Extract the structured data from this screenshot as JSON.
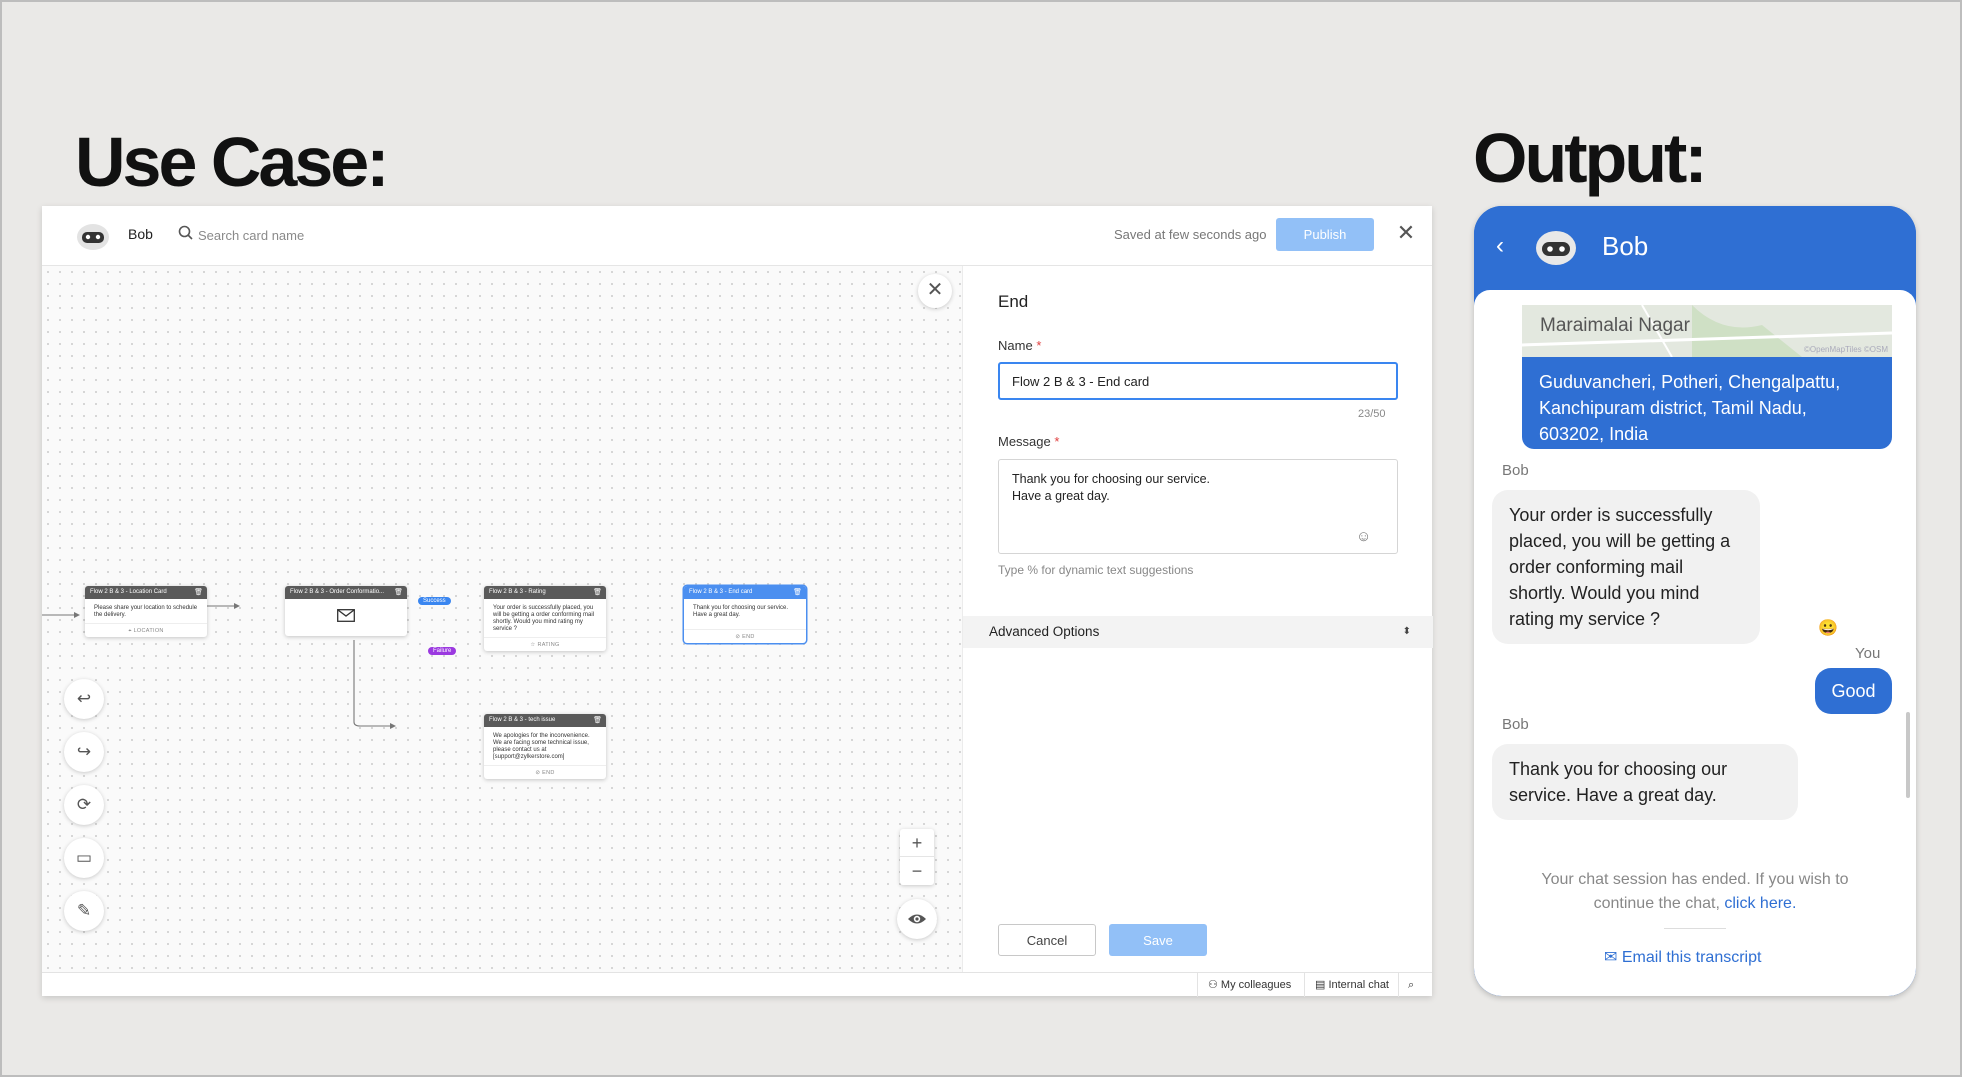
{
  "headings": {
    "left": "Use Case:",
    "right": "Output:"
  },
  "builder": {
    "bot_name": "Bob",
    "search_placeholder": "Search card name",
    "saved_status": "Saved at few seconds ago",
    "publish_label": "Publish",
    "close_glyph": "✕",
    "cards": [
      {
        "title": "Flow 2 B & 3 - Location Card",
        "body": "Please share your location to schedule the delivery.",
        "footer": "LOCATION",
        "icon": "pin-icon"
      },
      {
        "title": "Flow 2 B & 3 - Order Conformatio...",
        "body": "",
        "footer": "",
        "icon": "mail-icon"
      },
      {
        "title": "Flow 2 B & 3 - Rating",
        "body": "Your order is successfully placed, you will be getting a order conforming mail shortly. Would you mind rating my service ?",
        "footer": "RATING",
        "icon": "star-icon"
      },
      {
        "title": "Flow 2 B & 3 - End card",
        "body": "Thank you for choosing our service. Have a great day.",
        "footer": "END",
        "icon": "stop-icon"
      },
      {
        "title": "Flow 2 B & 3 - tech issue",
        "body": "We apologies for the inconvenience. We are facing some technical issue, please contact us at [support@zylkerstore.com]",
        "footer": "END",
        "icon": "stop-icon"
      }
    ],
    "branch_success": "Success",
    "branch_failure": "Failure",
    "zoom_in": "+",
    "zoom_out": "−",
    "colors": {
      "accent": "#3a86f0",
      "publish": "#92c0f7",
      "success": "#3a86f0",
      "failure": "#9b39e0"
    }
  },
  "panel": {
    "title": "End",
    "name_label": "Name",
    "name_value": "Flow 2 B & 3 - End card",
    "name_count": "23/50",
    "message_label": "Message",
    "message_line1": "Thank you for choosing our service.",
    "message_line2": "Have a great day.",
    "hint": "Type % for dynamic text suggestions",
    "advanced": "Advanced Options",
    "cancel": "Cancel",
    "save": "Save"
  },
  "statusbar": {
    "colleagues": "My colleagues",
    "internal_chat": "Internal chat"
  },
  "chat": {
    "title": "Bob",
    "map_place": "Maraimalai Nagar",
    "map_credit": "©OpenMapTiles ©OSM",
    "address": "Guduvancheri, Potheri, Chengalpattu, Kanchipuram district, Tamil Nadu, 603202, India",
    "sender_bot": "Bob",
    "sender_you": "You",
    "bot_msg_1": "Your order is successfully placed, you will be getting a order conforming mail shortly. Would you mind rating my service ?",
    "user_reply": "Good",
    "reaction": "😀",
    "bot_msg_2": "Thank you for choosing our service. Have a great day.",
    "ended_text": "Your chat session has ended. If you wish to continue the chat,",
    "ended_link": "click here.",
    "email_label": "Email this transcript",
    "accent": "#2f6fd3"
  }
}
